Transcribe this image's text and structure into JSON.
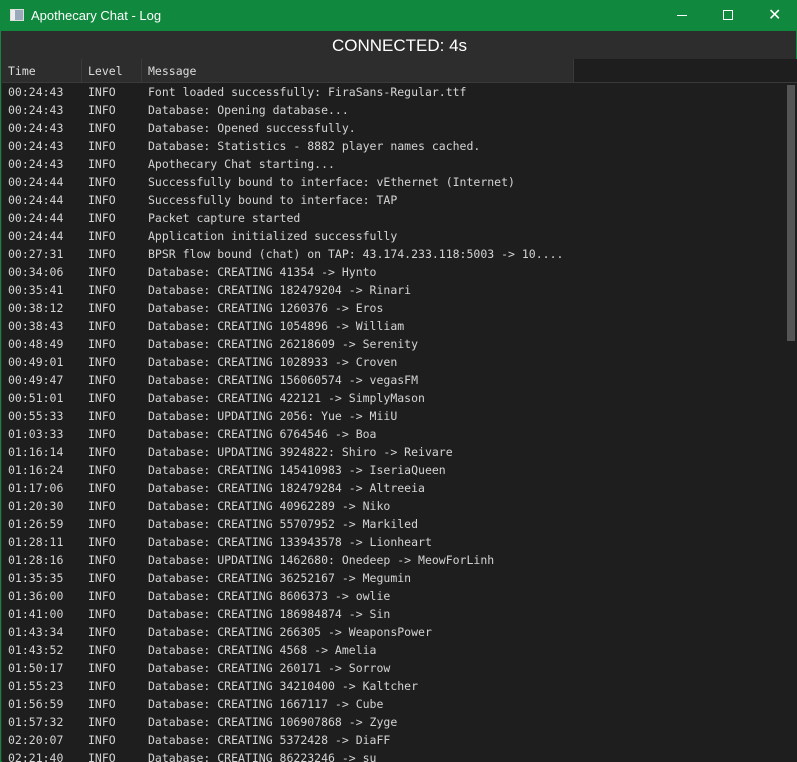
{
  "window": {
    "title": "Apothecary Chat - Log",
    "accent": "#10893e",
    "controls": [
      "minimize",
      "maximize",
      "close"
    ]
  },
  "status": "CONNECTED: 4s",
  "columns": [
    "Time",
    "Level",
    "Message"
  ],
  "rows": [
    [
      "00:24:43",
      "INFO",
      "Font loaded successfully: FiraSans-Regular.ttf"
    ],
    [
      "00:24:43",
      "INFO",
      "Database: Opening database..."
    ],
    [
      "00:24:43",
      "INFO",
      "Database: Opened successfully."
    ],
    [
      "00:24:43",
      "INFO",
      "Database: Statistics - 8882 player names cached."
    ],
    [
      "00:24:43",
      "INFO",
      "Apothecary Chat starting..."
    ],
    [
      "00:24:44",
      "INFO",
      "Successfully bound to interface: vEthernet (Internet)"
    ],
    [
      "00:24:44",
      "INFO",
      "Successfully bound to interface: TAP"
    ],
    [
      "00:24:44",
      "INFO",
      "Packet capture started"
    ],
    [
      "00:24:44",
      "INFO",
      "Application initialized successfully"
    ],
    [
      "00:27:31",
      "INFO",
      "BPSR flow bound (chat) on TAP: 43.174.233.118:5003 -> 10...."
    ],
    [
      "00:34:06",
      "INFO",
      "Database: CREATING 41354 -> Hynto"
    ],
    [
      "00:35:41",
      "INFO",
      "Database: CREATING 182479204 -> Rinari"
    ],
    [
      "00:38:12",
      "INFO",
      "Database: CREATING 1260376 -> Eros"
    ],
    [
      "00:38:43",
      "INFO",
      "Database: CREATING 1054896 -> William"
    ],
    [
      "00:48:49",
      "INFO",
      "Database: CREATING 26218609 -> Serenity"
    ],
    [
      "00:49:01",
      "INFO",
      "Database: CREATING 1028933 -> Croven"
    ],
    [
      "00:49:47",
      "INFO",
      "Database: CREATING 156060574 -> vegasFM"
    ],
    [
      "00:51:01",
      "INFO",
      "Database: CREATING 422121 -> SimplyMason"
    ],
    [
      "00:55:33",
      "INFO",
      "Database: UPDATING 2056: Yue -> MiiU"
    ],
    [
      "01:03:33",
      "INFO",
      "Database: CREATING 6764546 -> Boa"
    ],
    [
      "01:16:14",
      "INFO",
      "Database: UPDATING 3924822: Shiro -> Reivare"
    ],
    [
      "01:16:24",
      "INFO",
      "Database: CREATING 145410983 -> IseriaQueen"
    ],
    [
      "01:17:06",
      "INFO",
      "Database: CREATING 182479284 -> Altreeia"
    ],
    [
      "01:20:30",
      "INFO",
      "Database: CREATING 40962289 -> Niko"
    ],
    [
      "01:26:59",
      "INFO",
      "Database: CREATING 55707952 -> Markiled"
    ],
    [
      "01:28:11",
      "INFO",
      "Database: CREATING 133943578 -> Lionheart"
    ],
    [
      "01:28:16",
      "INFO",
      "Database: UPDATING 1462680: Onedeep -> MeowForLinh"
    ],
    [
      "01:35:35",
      "INFO",
      "Database: CREATING 36252167 -> Megumin"
    ],
    [
      "01:36:00",
      "INFO",
      "Database: CREATING 8606373 -> owlie"
    ],
    [
      "01:41:00",
      "INFO",
      "Database: CREATING 186984874 -> Sin"
    ],
    [
      "01:43:34",
      "INFO",
      "Database: CREATING 266305 -> WeaponsPower"
    ],
    [
      "01:43:52",
      "INFO",
      "Database: CREATING 4568 -> Amelia"
    ],
    [
      "01:50:17",
      "INFO",
      "Database: CREATING 260171 -> Sorrow"
    ],
    [
      "01:55:23",
      "INFO",
      "Database: CREATING 34210400 -> Kaltcher"
    ],
    [
      "01:56:59",
      "INFO",
      "Database: CREATING 1667117 -> Cube"
    ],
    [
      "01:57:32",
      "INFO",
      "Database: CREATING 106907868 -> Zyge"
    ],
    [
      "02:20:07",
      "INFO",
      "Database: CREATING 5372428 -> DiaFF"
    ],
    [
      "02:21:40",
      "INFO",
      "Database: CREATING 86223246 -> su"
    ]
  ]
}
